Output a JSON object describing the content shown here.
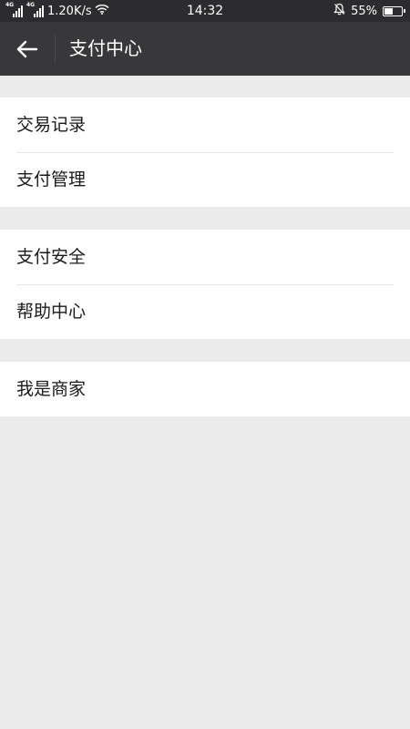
{
  "status_bar": {
    "network_type_1": "4G",
    "network_type_2": "4G",
    "speed": "1.20K/s",
    "time": "14:32",
    "battery": "55%",
    "battery_level": 0.55,
    "icons": [
      "signal-icon",
      "wifi-icon",
      "bell-off-icon",
      "battery-icon"
    ]
  },
  "header": {
    "title": "支付中心",
    "back_icon": "back-arrow-icon"
  },
  "groups": [
    {
      "items": [
        {
          "label": "交易记录"
        },
        {
          "label": "支付管理"
        }
      ]
    },
    {
      "items": [
        {
          "label": "支付安全"
        },
        {
          "label": "帮助中心"
        }
      ]
    },
    {
      "items": [
        {
          "label": "我是商家"
        }
      ]
    }
  ],
  "colors": {
    "status_bar_bg": "#2c2c2e",
    "nav_bg": "#38383a",
    "page_bg": "#ebebeb",
    "item_bg": "#ffffff",
    "text": "#1a1a1a"
  }
}
